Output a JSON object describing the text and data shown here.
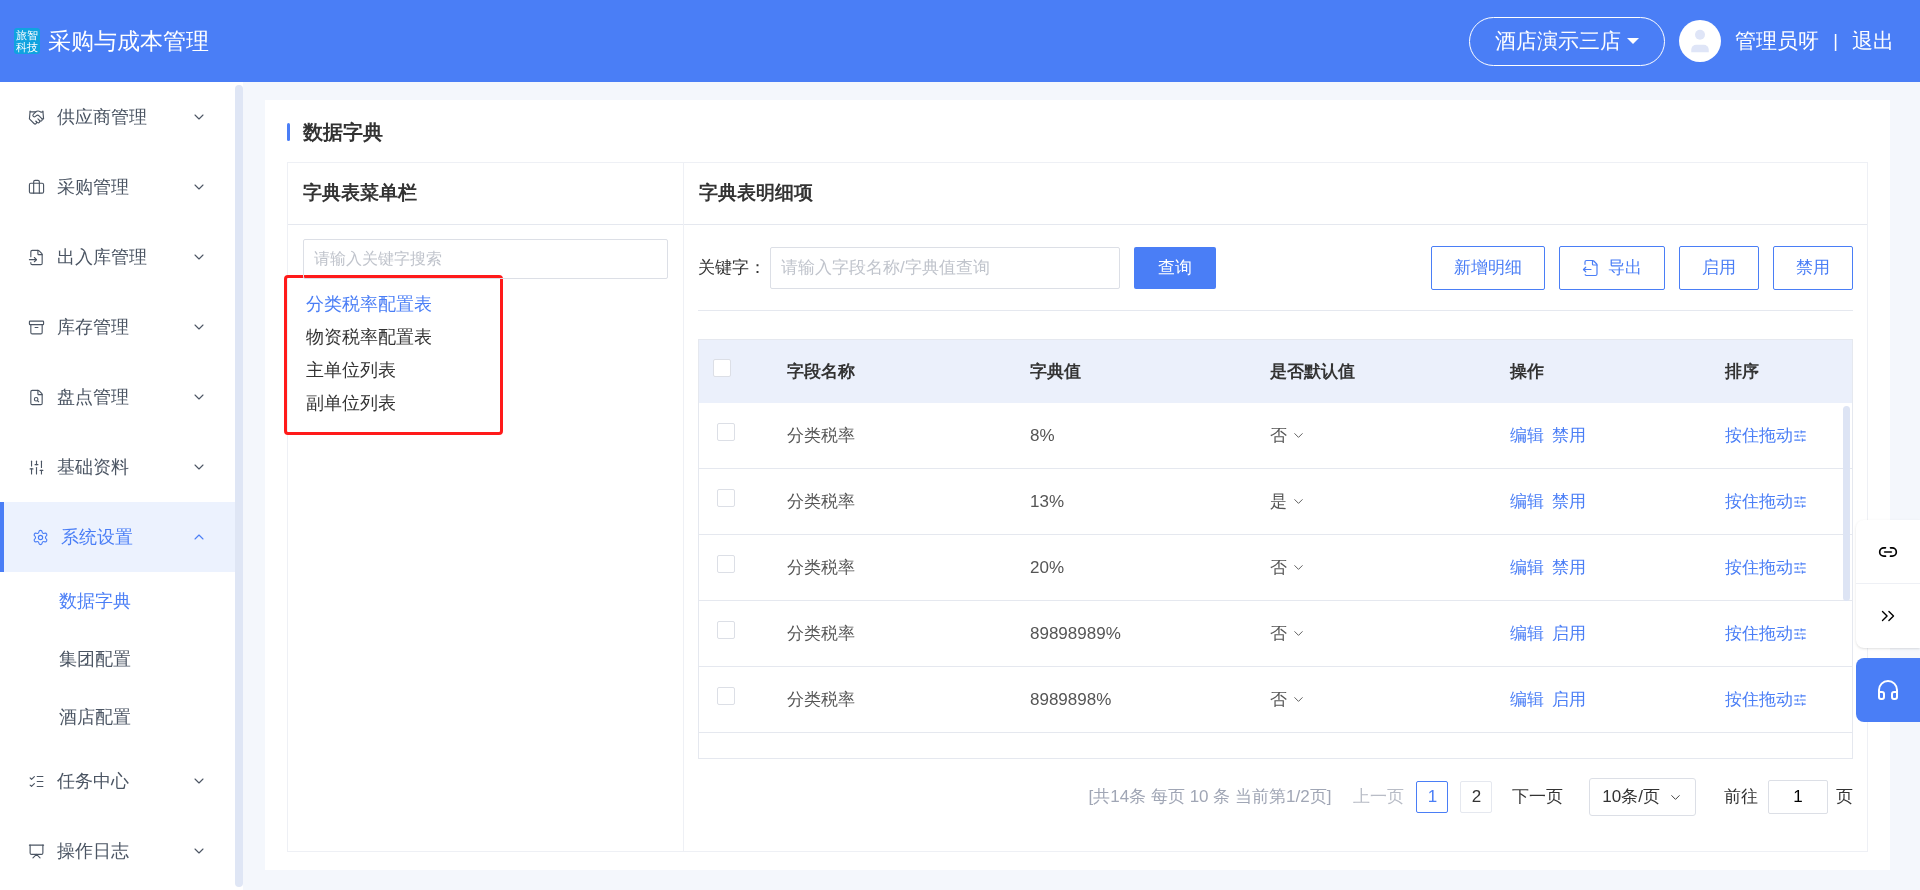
{
  "header": {
    "logo_lines": [
      "旅智",
      "科技"
    ],
    "title": "采购与成本管理",
    "store": "酒店演示三店",
    "user": "管理员呀",
    "separator": "|",
    "logout": "退出"
  },
  "sidebar": {
    "items": [
      {
        "label": "供应商管理",
        "expanded": false,
        "selected": false
      },
      {
        "label": "采购管理",
        "expanded": false,
        "selected": false
      },
      {
        "label": "出入库管理",
        "expanded": false,
        "selected": false
      },
      {
        "label": "库存管理",
        "expanded": false,
        "selected": false
      },
      {
        "label": "盘点管理",
        "expanded": false,
        "selected": false
      },
      {
        "label": "基础资料",
        "expanded": false,
        "selected": false
      },
      {
        "label": "系统设置",
        "expanded": true,
        "selected": true,
        "children": [
          {
            "label": "数据字典",
            "selected": true
          },
          {
            "label": "集团配置",
            "selected": false
          },
          {
            "label": "酒店配置",
            "selected": false
          }
        ]
      },
      {
        "label": "任务中心",
        "expanded": false,
        "selected": false
      },
      {
        "label": "操作日志",
        "expanded": false,
        "selected": false
      }
    ]
  },
  "page": {
    "title": "数据字典"
  },
  "menu_panel": {
    "title": "字典表菜单栏",
    "search": {
      "placeholder": "请输入关键字搜索"
    },
    "highlighted": true,
    "items": [
      {
        "label": "分类税率配置表",
        "selected": true
      },
      {
        "label": "物资税率配置表",
        "selected": false
      },
      {
        "label": "主单位列表",
        "selected": false
      },
      {
        "label": "副单位列表",
        "selected": false
      }
    ]
  },
  "detail_panel": {
    "title": "字典表明细项",
    "keyword_label": "关键字：",
    "keyword": {
      "placeholder": "请输入字段名称/字典值查询"
    },
    "query_button": "查询",
    "buttons": [
      {
        "label": "新增明细",
        "kind": "plain"
      },
      {
        "label": "导出",
        "kind": "export"
      },
      {
        "label": "启用",
        "kind": "plain"
      },
      {
        "label": "禁用",
        "kind": "plain"
      }
    ],
    "table": {
      "header_checked": false,
      "columns": [
        "字段名称",
        "字典值",
        "是否默认值",
        "操作",
        "排序"
      ],
      "rows": [
        {
          "checked": false,
          "name": "分类税率",
          "value": "8%",
          "default": "否",
          "actions": [
            "编辑",
            "禁用"
          ],
          "sort": "按住拖动"
        },
        {
          "checked": false,
          "name": "分类税率",
          "value": "13%",
          "default": "是",
          "actions": [
            "编辑",
            "禁用"
          ],
          "sort": "按住拖动"
        },
        {
          "checked": false,
          "name": "分类税率",
          "value": "20%",
          "default": "否",
          "actions": [
            "编辑",
            "禁用"
          ],
          "sort": "按住拖动"
        },
        {
          "checked": false,
          "name": "分类税率",
          "value": "89898989%",
          "default": "否",
          "actions": [
            "编辑",
            "启用"
          ],
          "sort": "按住拖动"
        },
        {
          "checked": false,
          "name": "分类税率",
          "value": "8989898%",
          "default": "否",
          "actions": [
            "编辑",
            "启用"
          ],
          "sort": "按住拖动"
        }
      ]
    },
    "pagination": {
      "summary": "[共14条 每页 10 条 当前第1/2页]",
      "prev": {
        "label": "上一页",
        "disabled": true
      },
      "pages": [
        {
          "label": "1",
          "selected": true
        },
        {
          "label": "2",
          "selected": false
        }
      ],
      "next": {
        "label": "下一页",
        "disabled": false
      },
      "page_size": "10条/页",
      "goto_label": "前往",
      "goto_value": "1",
      "goto_suffix": "页"
    }
  }
}
